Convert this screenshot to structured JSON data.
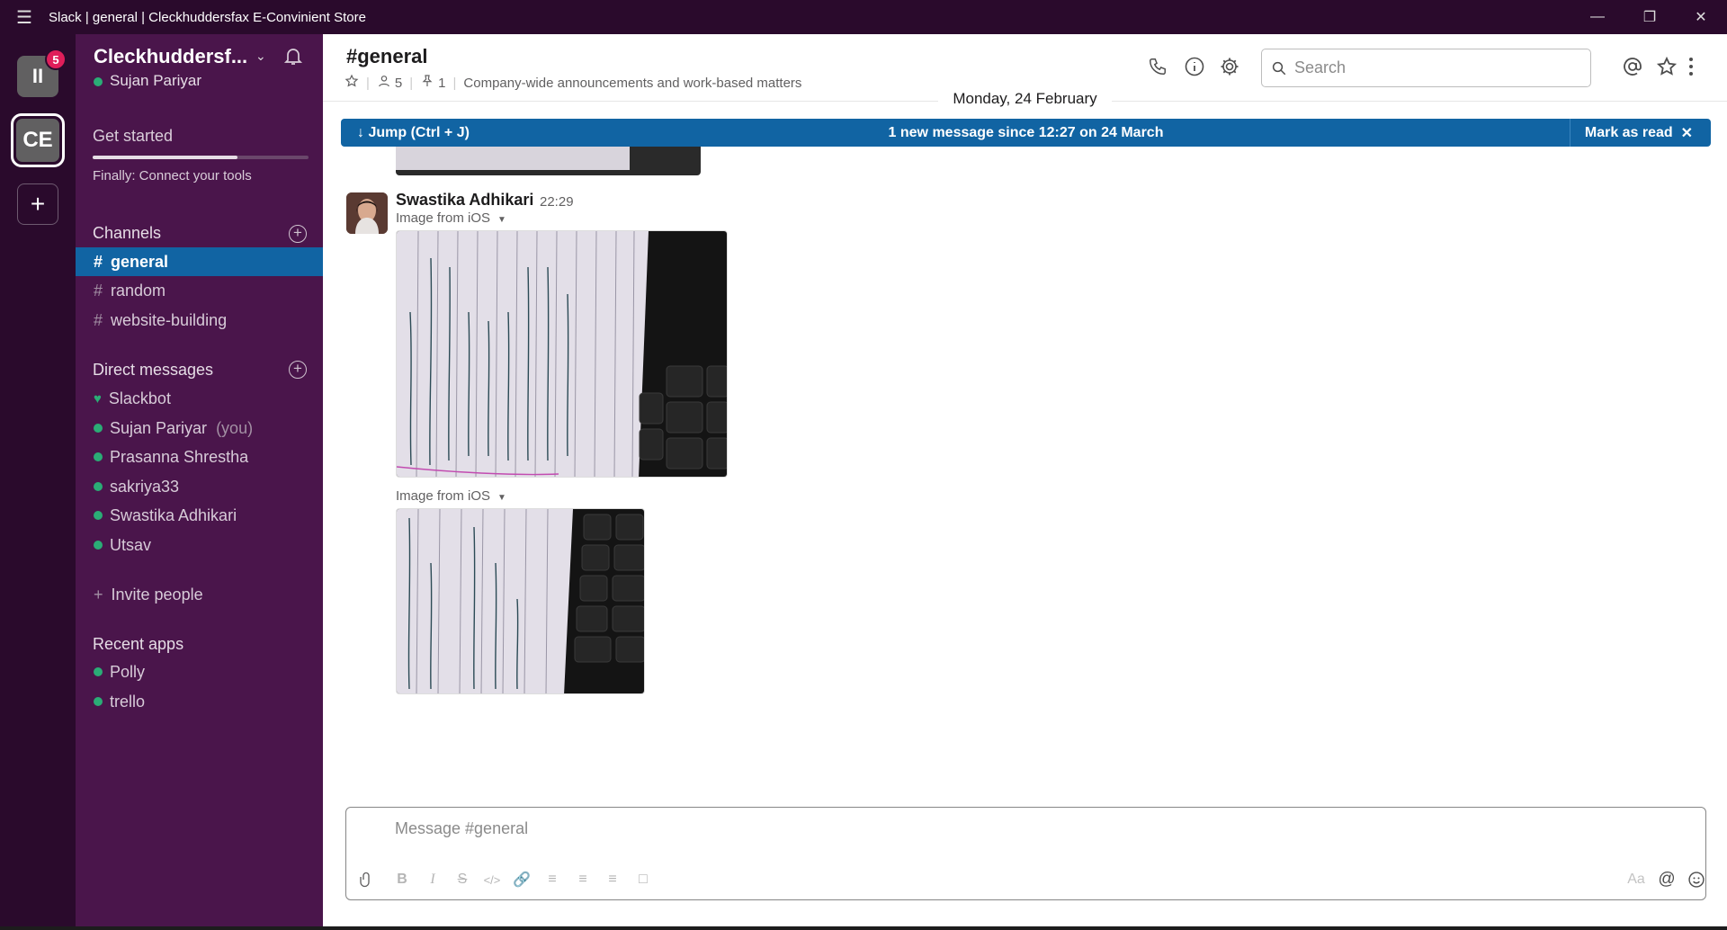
{
  "window": {
    "title": "Slack | general | Cleckhuddersfax E-Convinient Store",
    "menu_icon": "hamburger-icon",
    "controls": [
      "minimize-icon",
      "restore-icon",
      "close-icon"
    ]
  },
  "workspaces": {
    "items": [
      {
        "initials": "II",
        "badge": "5"
      },
      {
        "initials": "CE"
      }
    ],
    "add_label": "+"
  },
  "sidebar": {
    "team_name": "Cleckhuddersf...",
    "user_name": "Sujan Pariyar",
    "get_started": "Get started",
    "get_started_progress": 0.67,
    "get_started_sub": "Finally: Connect your tools",
    "channels_heading": "Channels",
    "channels": [
      {
        "name": "general",
        "active": true
      },
      {
        "name": "random"
      },
      {
        "name": "website-building"
      }
    ],
    "dm_heading": "Direct messages",
    "dms": [
      {
        "name": "Slackbot",
        "icon": "heart-icon"
      },
      {
        "name": "Sujan Pariyar",
        "suffix": "(you)"
      },
      {
        "name": "Prasanna Shrestha"
      },
      {
        "name": "sakriya33"
      },
      {
        "name": "Swastika Adhikari"
      },
      {
        "name": "Utsav"
      }
    ],
    "invite": "Invite people",
    "apps_heading": "Recent apps",
    "apps": [
      {
        "name": "Polly"
      },
      {
        "name": "trello"
      }
    ]
  },
  "channel": {
    "title": "#general",
    "members": "5",
    "pins": "1",
    "description": "Company-wide announcements and work-based matters",
    "search_placeholder": "Search"
  },
  "feed": {
    "date_divider": "Monday, 24 February",
    "jump_label": "Jump (Ctrl + J)",
    "new_messages": "1 new message since 12:27 on 24 March",
    "mark_read": "Mark as read",
    "message": {
      "sender": "Swastika Adhikari",
      "time": "22:29",
      "attachments": [
        {
          "label": "Image from iOS"
        },
        {
          "label": "Image from iOS"
        }
      ]
    }
  },
  "composer": {
    "placeholder": "Message #general",
    "format_label": "Aa"
  },
  "colors": {
    "sidebar": "#4a154b",
    "rail": "#2a0a2c",
    "accent": "#1164a3",
    "presence": "#2bac76",
    "badge": "#e01e5a"
  }
}
